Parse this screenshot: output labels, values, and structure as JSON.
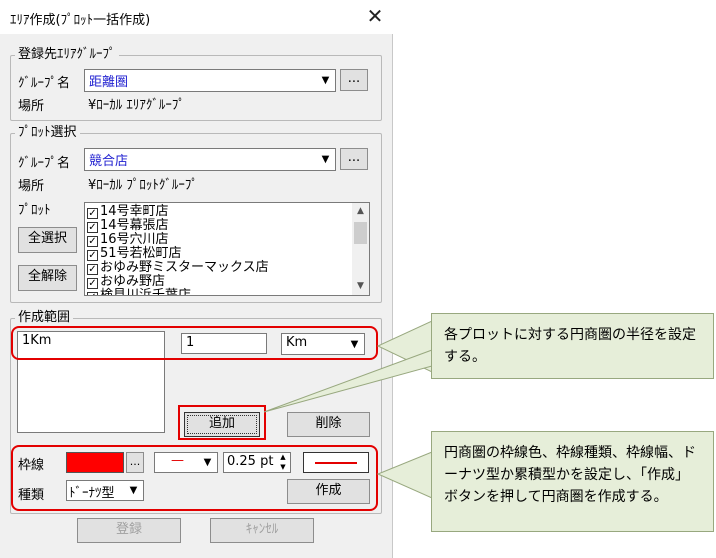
{
  "window": {
    "title": "ｴﾘｱ作成(ﾌﾟﾛｯﾄ一括作成)",
    "close_glyph": "✕"
  },
  "registration_group": {
    "legend": "登録先ｴﾘｱｸﾞﾙｰﾌﾟ",
    "group_name_label": "ｸﾞﾙｰﾌﾟ名",
    "group_name_value": "距離圏",
    "location_label": "場所",
    "location_value": "¥ﾛｰｶﾙ ｴﾘｱｸﾞﾙｰﾌﾟ",
    "browse_label": "..."
  },
  "plot_selection": {
    "legend": "ﾌﾟﾛｯﾄ選択",
    "group_name_label": "ｸﾞﾙｰﾌﾟ名",
    "group_name_value": "競合店",
    "location_label": "場所",
    "location_value": "¥ﾛｰｶﾙ ﾌﾟﾛｯﾄｸﾞﾙｰﾌﾟ",
    "plot_label": "ﾌﾟﾛｯﾄ",
    "browse_label": "...",
    "select_all_label": "全選択",
    "deselect_all_label": "全解除",
    "check_glyph": "✓",
    "plots": [
      "14号幸町店",
      "14号幕張店",
      "16号穴川店",
      "51号若松町店",
      "おゆみ野ミスターマックス店",
      "おゆみ野店",
      "検見川浜千葉店"
    ]
  },
  "range": {
    "legend": "作成範囲",
    "list_items": [
      "1Km"
    ],
    "radius_value": "1",
    "unit_value": "Km",
    "add_label": "追加",
    "delete_label": "削除"
  },
  "style": {
    "border_label": "枠線",
    "fill_color": "#ff0000",
    "color_browse_label": "...",
    "line_style_value": "—",
    "line_width_value": "0.25 pt",
    "type_label": "種類",
    "type_value": "ﾄﾞｰﾅﾂ型",
    "create_label": "作成"
  },
  "footer": {
    "register_label": "登録",
    "cancel_label": "ｷｬﾝｾﾙ"
  },
  "callouts": {
    "top": "各プロットに対する円商圏の半径を設定する。",
    "bottom": "円商圏の枠線色、枠線種類、枠線幅、ドーナツ型か累積型かを設定し、「作成」ボタンを押して円商圏を作成する。"
  },
  "icons": {
    "dropdown": "chevron-down-icon",
    "spin_up": "spin-up-icon",
    "spin_down": "spin-down-icon",
    "close": "close-icon",
    "scroll_up": "scroll-up-icon",
    "scroll_down": "scroll-down-icon"
  },
  "colors": {
    "highlight": "#e30000",
    "callout_bg": "#e6eed9",
    "link_text": "#1f1fd0"
  }
}
